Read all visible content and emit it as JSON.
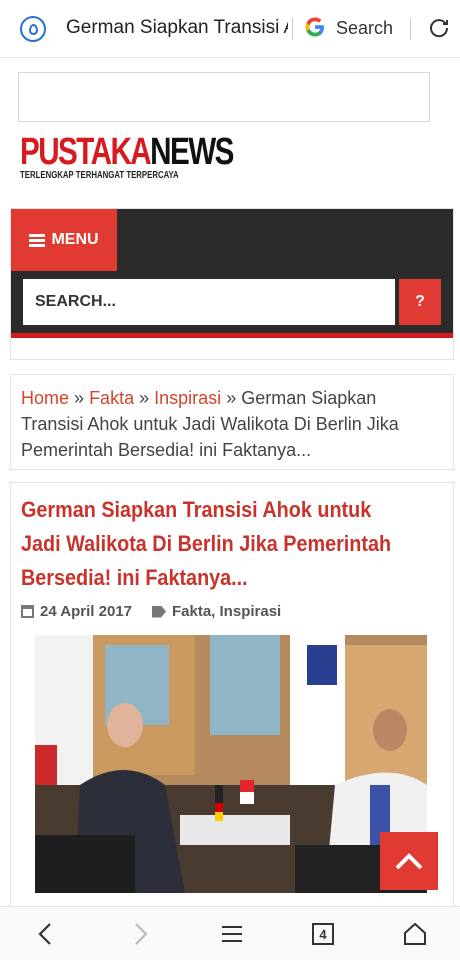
{
  "browser": {
    "page_title": "German Siapkan Transisi Ahok untuk Jadi Walikota Di Berlin Jika Pemerintah Bersedia! ini Faktanya...",
    "search_label": "Search",
    "tab_count": "4"
  },
  "site": {
    "logo_part1": "PUSTAKA",
    "logo_part2": "NEWS",
    "tagline": "TERLENGKAP TERHANGAT TERPERCAYA"
  },
  "nav": {
    "menu_label": "MENU",
    "search_placeholder": "SEARCH...",
    "search_button": "?"
  },
  "breadcrumb": {
    "home": "Home",
    "sep": "»",
    "fakta": "Fakta",
    "inspirasi": "Inspirasi",
    "current": "German Siapkan Transisi Ahok untuk Jadi Walikota Di Berlin Jika Pemerintah Bersedia! ini Faktanya..."
  },
  "article": {
    "title": "German Siapkan Transisi Ahok untuk Jadi Walikota Di Berlin Jika Pemerintah Bersedia! ini Faktanya...",
    "date": "24 April 2017",
    "categories": "Fakta, Inspirasi"
  },
  "colors": {
    "accent_red": "#e03a32",
    "title_red": "#c8332c",
    "nav_dark": "#2b2b2b"
  }
}
